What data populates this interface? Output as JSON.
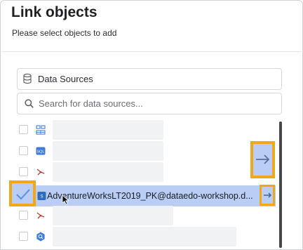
{
  "dialog": {
    "title": "Link objects",
    "subtitle": "Please select objects to add"
  },
  "source_select": {
    "selected": "Data Sources",
    "icon": "database-icon"
  },
  "search": {
    "placeholder": "Search for data sources...",
    "value": ""
  },
  "list": {
    "items": [
      {
        "label": "",
        "icon": "grid-table-icon",
        "checked": false
      },
      {
        "label": "",
        "icon": "sql-icon",
        "checked": false
      },
      {
        "label": "",
        "icon": "snowflake-icon",
        "checked": false
      },
      {
        "label": "AdventureWorksLT2019_PK@dataedo-workshop.d...",
        "icon": "sql-server-icon",
        "checked": true,
        "selected": true
      },
      {
        "label": "",
        "icon": "snowflake-icon",
        "checked": false
      },
      {
        "label": "",
        "icon": "bigquery-icon",
        "checked": false
      }
    ]
  },
  "actions": {
    "arrow_glyph": "→"
  },
  "colors": {
    "highlight_orange": "#f0a818",
    "selection_blue": "#b9cdf5",
    "accent_blue": "#2f6fd6"
  }
}
